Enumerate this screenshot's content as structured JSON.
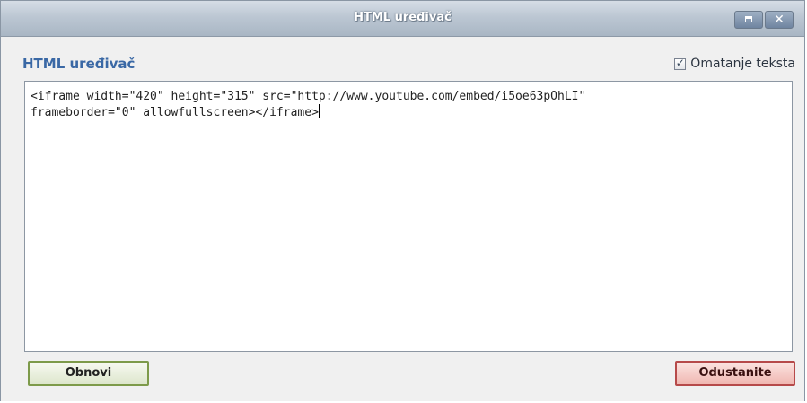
{
  "window": {
    "title": "HTML uređivač",
    "maximize_icon": "maximize-icon",
    "close_icon": "close-icon",
    "close_glyph": "✕"
  },
  "dialog": {
    "heading": "HTML uređivač",
    "wrap_option": {
      "label": "Omatanje teksta",
      "checked": true,
      "check_glyph": "✓"
    },
    "editor": {
      "line1": "<iframe width=\"420\" height=\"315\" src=\"http://www.youtube.com/embed/i5oe63pOhLI\"",
      "line2": "frameborder=\"0\" allowfullscreen></iframe>"
    },
    "buttons": {
      "restore_label": "Obnovi",
      "cancel_label": "Odustanite"
    }
  },
  "colors": {
    "heading": "#3a68a5",
    "restore_border": "#7d9a4a",
    "cancel_border": "#b64a4a"
  }
}
